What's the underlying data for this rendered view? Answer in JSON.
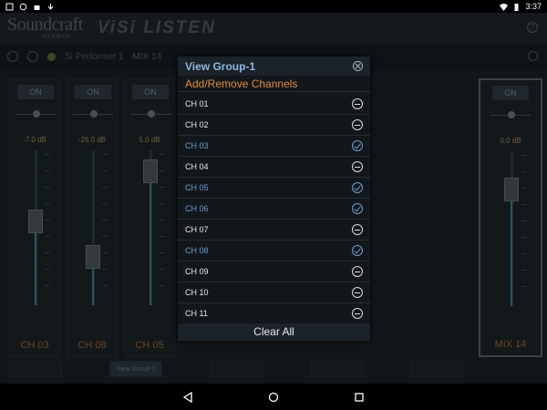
{
  "status": {
    "time": "3:37"
  },
  "header": {
    "brand": "Soundcraft",
    "brand_sub": "HARMAN",
    "app_title": "ViSi LISTEN"
  },
  "toolbar": {
    "performer": "Si Performer 1",
    "mix": "MIX 14"
  },
  "strips": [
    {
      "on": "ON",
      "db": "-7.0 dB",
      "label": "CH 03",
      "level": 0.55
    },
    {
      "on": "ON",
      "db": "-26.0 dB",
      "label": "CH 08",
      "level": 0.28
    },
    {
      "on": "ON",
      "db": "5.0 dB",
      "label": "CH 05",
      "level": 0.93
    },
    {
      "on": "ON",
      "db": "0.0 dB",
      "label": "MIX 14",
      "level": 0.8
    }
  ],
  "groups": [
    "View Group-1"
  ],
  "modal": {
    "title": "View Group-1",
    "subtitle": "Add/Remove Channels",
    "footer": "Clear All",
    "channels": [
      {
        "name": "CH 01",
        "selected": false
      },
      {
        "name": "CH 02",
        "selected": false
      },
      {
        "name": "CH 03",
        "selected": true
      },
      {
        "name": "CH 04",
        "selected": false
      },
      {
        "name": "CH 05",
        "selected": true
      },
      {
        "name": "CH 06",
        "selected": true
      },
      {
        "name": "CH 07",
        "selected": false
      },
      {
        "name": "CH 08",
        "selected": true
      },
      {
        "name": "CH 09",
        "selected": false
      },
      {
        "name": "CH 10",
        "selected": false
      },
      {
        "name": "CH 11",
        "selected": false
      }
    ]
  }
}
